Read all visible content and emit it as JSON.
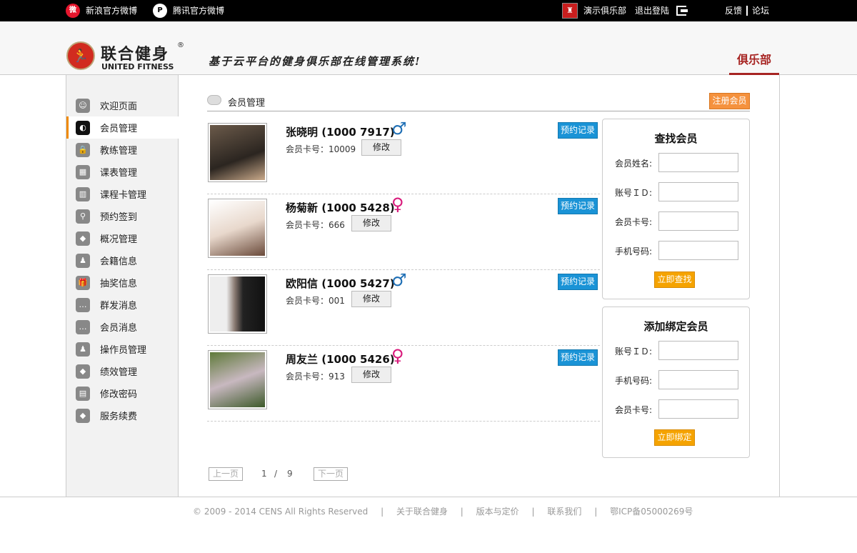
{
  "topbar": {
    "weibo_label": "新浪官方微博",
    "tqq_label": "腾讯官方微博",
    "club_name": "演示俱乐部",
    "logout_label": "退出登陆",
    "feedback_label": "反馈",
    "forum_label": "论坛"
  },
  "header": {
    "brand_cn": "联合健身",
    "brand_reg": "®",
    "brand_en": "UNITED FITNESS",
    "slogan": "基于云平台的健身俱乐部在线管理系统!",
    "active_tab": "俱乐部"
  },
  "sidebar": {
    "items": [
      {
        "label": "欢迎页面",
        "icon": "smiley-icon"
      },
      {
        "label": "会员管理",
        "icon": "pacman-icon"
      },
      {
        "label": "教练管理",
        "icon": "lock-icon"
      },
      {
        "label": "课表管理",
        "icon": "calendar-icon"
      },
      {
        "label": "课程卡管理",
        "icon": "barcode-icon"
      },
      {
        "label": "预约签到",
        "icon": "map-pin-icon"
      },
      {
        "label": "概况管理",
        "icon": "diamond-icon"
      },
      {
        "label": "会籍信息",
        "icon": "users-icon"
      },
      {
        "label": "抽奖信息",
        "icon": "gift-icon"
      },
      {
        "label": "群发消息",
        "icon": "chat-icon"
      },
      {
        "label": "会员消息",
        "icon": "chat-icon"
      },
      {
        "label": "操作员管理",
        "icon": "users-icon"
      },
      {
        "label": "绩效管理",
        "icon": "diamond-icon"
      },
      {
        "label": "修改密码",
        "icon": "id-card-icon"
      },
      {
        "label": "服务续费",
        "icon": "diamond-icon"
      }
    ],
    "active_index": 1
  },
  "main": {
    "section_title": "会员管理",
    "register_label": "注册会员",
    "card_label": "会员卡号：",
    "edit_label": "修改",
    "appointment_label": "预约记录",
    "members": [
      {
        "name": "张晓明 (1000 7917)",
        "gender": "male",
        "gender_symbol": "♂",
        "card_no": "10009"
      },
      {
        "name": "杨菊新 (1000 5428)",
        "gender": "female",
        "gender_symbol": "♀",
        "card_no": "666"
      },
      {
        "name": "欧阳信 (1000 5427)",
        "gender": "male",
        "gender_symbol": "♂",
        "card_no": "001"
      },
      {
        "name": "周友兰 (1000 5426)",
        "gender": "female",
        "gender_symbol": "♀",
        "card_no": "913"
      }
    ],
    "pager": {
      "prev_label": "上一页",
      "current_page": "1",
      "separator": "/",
      "total_pages": "9",
      "next_label": "下一页"
    }
  },
  "find_panel": {
    "title": "查找会员",
    "fields": [
      "会员姓名:",
      "账号ＩＤ:",
      "会员卡号:",
      "手机号码:"
    ],
    "button": "立即查找"
  },
  "bind_panel": {
    "title": "添加绑定会员",
    "fields": [
      "账号ＩＤ:",
      "手机号码:",
      "会员卡号:"
    ],
    "button": "立即绑定"
  },
  "footer": {
    "copyright": "© 2009 - 2014 CENS All Rights Reserved",
    "sep": "|",
    "links": [
      "关于联合健身",
      "版本与定价",
      "联系我们"
    ],
    "icp": "鄂ICP备05000269号"
  },
  "colors": {
    "accent_red": "#a72422",
    "orange": "#f5a300",
    "blue": "#1a93d6",
    "male": "#1f6fb5",
    "female": "#d8197b"
  }
}
